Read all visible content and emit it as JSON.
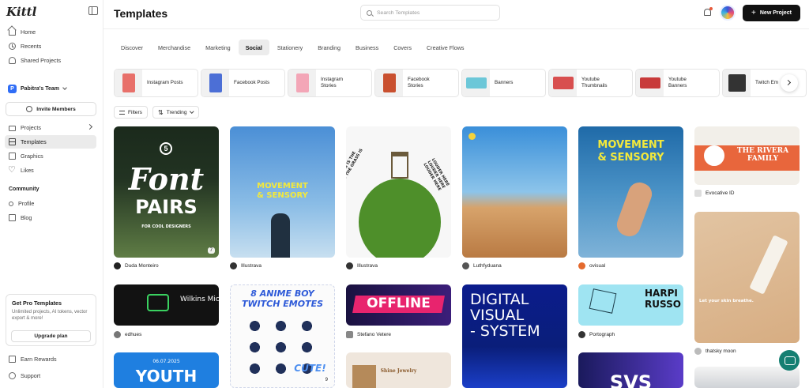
{
  "app": {
    "logo": "Kittl"
  },
  "sidebar": {
    "nav_top": [
      {
        "label": "Home",
        "icon": "home-icon"
      },
      {
        "label": "Recents",
        "icon": "clock-icon"
      },
      {
        "label": "Shared Projects",
        "icon": "shared-icon"
      }
    ],
    "team": {
      "initial": "P",
      "name": "Pabitra's Team"
    },
    "invite_label": "Invite Members",
    "nav_main": [
      {
        "label": "Projects",
        "icon": "folder-icon"
      },
      {
        "label": "Templates",
        "icon": "templates-icon",
        "active": true
      },
      {
        "label": "Graphics",
        "icon": "image-icon"
      },
      {
        "label": "Likes",
        "icon": "heart-icon"
      }
    ],
    "community_label": "Community",
    "nav_community": [
      {
        "label": "Profile",
        "icon": "person-icon"
      },
      {
        "label": "Blog",
        "icon": "book-icon"
      }
    ],
    "pro_card": {
      "title": "Get Pro Templates",
      "description": "Unlimited projects, AI tokens, vector export & more!",
      "button": "Upgrade plan"
    },
    "nav_bottom": [
      {
        "label": "Earn Rewards",
        "icon": "gift-icon"
      },
      {
        "label": "Support",
        "icon": "help-icon"
      }
    ]
  },
  "header": {
    "title": "Templates",
    "search_placeholder": "Search Templates",
    "new_project_label": "New Project"
  },
  "tabs": [
    "Discover",
    "Merchandise",
    "Marketing",
    "Social",
    "Stationery",
    "Branding",
    "Business",
    "Covers",
    "Creative Flows"
  ],
  "active_tab": "Social",
  "categories": [
    {
      "label": "Instagram Posts",
      "color": "#e8706a"
    },
    {
      "label": "Facebook Posts",
      "color": "#4c6fd6"
    },
    {
      "label": "Instagram Stories",
      "color": "#f3a6b7"
    },
    {
      "label": "Facebook Stories",
      "color": "#c9502f"
    },
    {
      "label": "Banners",
      "color": "#6cc7d8"
    },
    {
      "label": "Youtube Thumbnails",
      "color": "#d84f4f"
    },
    {
      "label": "Youtube Banners",
      "color": "#c83a3a"
    },
    {
      "label": "Twitch Em",
      "color": "#333333"
    }
  ],
  "filters": {
    "filters_label": "Filters",
    "sort_label": "Trending"
  },
  "cards": {
    "c1": {
      "author": "Duda Monteiro",
      "count": "7",
      "line1": "Font",
      "line2": "PAIRS",
      "sub": "FOR COOL DESIGNERS",
      "num": "5"
    },
    "c2": {
      "author": "Illustrava",
      "line1": "MOVEMENT",
      "line2": "& SENSORY"
    },
    "c3": {
      "author": "Illustrava",
      "text_left": "THE GRASS IS THE GRASS IS THE GRASS IS",
      "text_right": "LOUDER HERE LOUDER HERE LOUDER HERE"
    },
    "c4": {
      "author": "Luthfyduana"
    },
    "c5": {
      "author": "ovisual",
      "line1": "MOVEMENT",
      "line2": "& SENSORY"
    },
    "c6": {
      "author": "Evocative ID",
      "line1": "THE RIVERA",
      "line2": "FAMILY"
    },
    "c7": {
      "author": "thatsky moon",
      "caption": "Let your skin breathe."
    },
    "c8": {
      "author": "edhues",
      "line1": "Wilkins Mic"
    },
    "c9": {
      "author": "",
      "count": "9",
      "line1": "8 ANIME BOY",
      "line2": "TWITCH EMOTES",
      "badge": "CUTE!"
    },
    "c10": {
      "author": "Stefano Vetere",
      "line1": "OFFLINE"
    },
    "c11": {
      "author": "",
      "line1": "DIGITAL",
      "line2": "VISUAL",
      "line3": "- SYSTEM"
    },
    "c12": {
      "author": "Portograph",
      "line1": "HARPI",
      "line2": "RUSSO"
    },
    "c13": {
      "author": "",
      "date": "06.07.2025",
      "line1": "YOUTH"
    },
    "c14": {
      "author": "",
      "line1": "Shine Jewelry"
    },
    "c15": {
      "author": "",
      "line1": "SVS"
    }
  }
}
